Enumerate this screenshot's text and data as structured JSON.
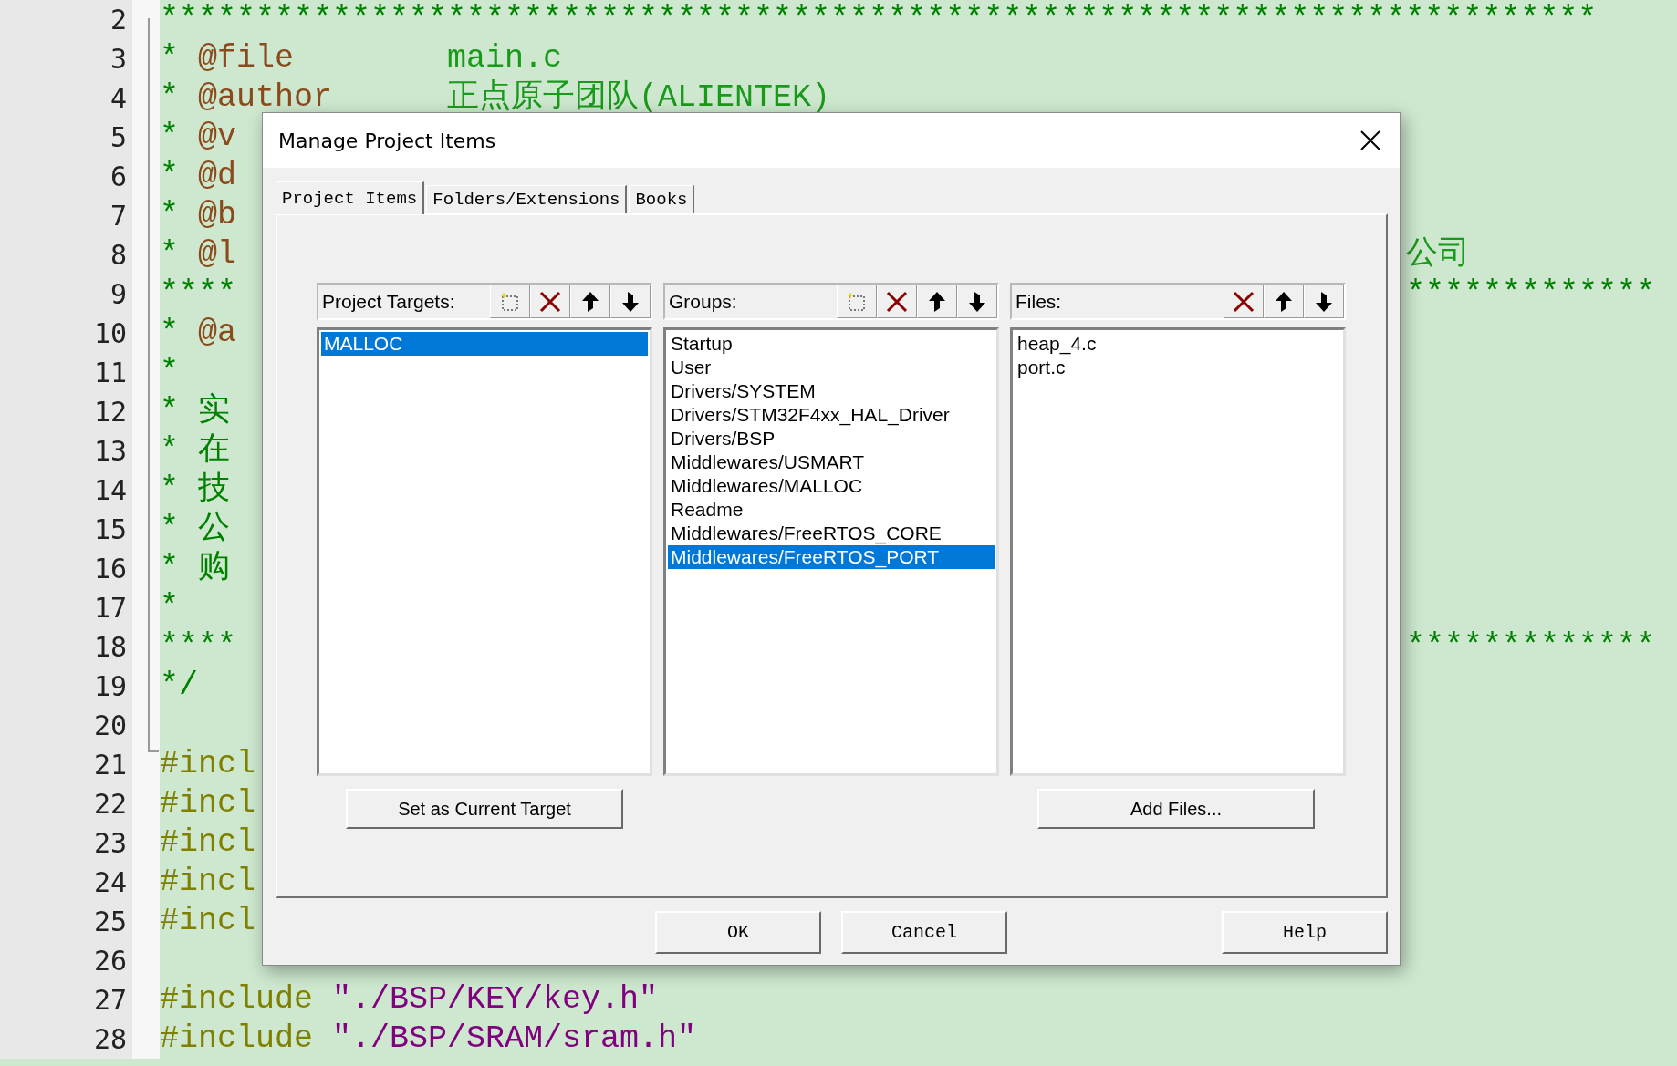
{
  "editor": {
    "lines": [
      {
        "number": "2",
        "parts": [
          {
            "kind": "comment",
            "text": "***************************************************************************"
          }
        ]
      },
      {
        "number": "3",
        "parts": [
          {
            "kind": "comment",
            "text": "* "
          },
          {
            "kind": "tag",
            "text": "@file"
          },
          {
            "kind": "value",
            "text": "        main.c"
          }
        ]
      },
      {
        "number": "4",
        "parts": [
          {
            "kind": "comment",
            "text": "* "
          },
          {
            "kind": "tag",
            "text": "@author"
          },
          {
            "kind": "value",
            "text": "      正点原子团队(ALIENTEK)"
          }
        ]
      },
      {
        "number": "5",
        "parts": [
          {
            "kind": "comment",
            "text": "* "
          },
          {
            "kind": "tag",
            "text": "@v"
          }
        ]
      },
      {
        "number": "6",
        "parts": [
          {
            "kind": "comment",
            "text": "* "
          },
          {
            "kind": "tag",
            "text": "@d"
          }
        ]
      },
      {
        "number": "7",
        "parts": [
          {
            "kind": "comment",
            "text": "* "
          },
          {
            "kind": "tag",
            "text": "@b"
          }
        ]
      },
      {
        "number": "8",
        "parts": [
          {
            "kind": "comment",
            "text": "* "
          },
          {
            "kind": "tag",
            "text": "@l"
          }
        ],
        "right": {
          "kind": "value",
          "text": "公司"
        }
      },
      {
        "number": "9",
        "parts": [
          {
            "kind": "comment",
            "text": "****"
          }
        ],
        "right": {
          "kind": "comment",
          "text": "*************"
        }
      },
      {
        "number": "10",
        "parts": [
          {
            "kind": "comment",
            "text": "* "
          },
          {
            "kind": "tag",
            "text": "@a"
          }
        ]
      },
      {
        "number": "11",
        "parts": [
          {
            "kind": "comment",
            "text": "*"
          }
        ]
      },
      {
        "number": "12",
        "parts": [
          {
            "kind": "comment",
            "text": "* 实"
          }
        ]
      },
      {
        "number": "13",
        "parts": [
          {
            "kind": "comment",
            "text": "* 在"
          }
        ]
      },
      {
        "number": "14",
        "parts": [
          {
            "kind": "comment",
            "text": "* 技"
          }
        ]
      },
      {
        "number": "15",
        "parts": [
          {
            "kind": "comment",
            "text": "* 公"
          }
        ]
      },
      {
        "number": "16",
        "parts": [
          {
            "kind": "comment",
            "text": "* 购"
          }
        ]
      },
      {
        "number": "17",
        "parts": [
          {
            "kind": "comment",
            "text": "*"
          }
        ]
      },
      {
        "number": "18",
        "parts": [
          {
            "kind": "comment",
            "text": "****"
          }
        ],
        "right": {
          "kind": "comment",
          "text": "*************"
        }
      },
      {
        "number": "19",
        "parts": [
          {
            "kind": "comment",
            "text": "*/"
          }
        ]
      },
      {
        "number": "20"
      },
      {
        "number": "21",
        "parts": [
          {
            "kind": "preproc",
            "text": "#incl"
          }
        ]
      },
      {
        "number": "22",
        "parts": [
          {
            "kind": "preproc",
            "text": "#incl"
          }
        ]
      },
      {
        "number": "23",
        "parts": [
          {
            "kind": "preproc",
            "text": "#incl"
          }
        ]
      },
      {
        "number": "24",
        "parts": [
          {
            "kind": "preproc",
            "text": "#incl"
          }
        ]
      },
      {
        "number": "25",
        "parts": [
          {
            "kind": "preproc",
            "text": "#incl"
          }
        ]
      },
      {
        "number": "26"
      },
      {
        "number": "27",
        "parts": [
          {
            "kind": "preproc",
            "text": "#include "
          },
          {
            "kind": "string",
            "text": "\"./BSP/KEY/key.h\""
          }
        ]
      },
      {
        "number": "28",
        "parts": [
          {
            "kind": "preproc",
            "text": "#include "
          },
          {
            "kind": "string",
            "text": "\"./BSP/SRAM/sram.h\""
          }
        ]
      }
    ]
  },
  "dialog": {
    "title": "Manage Project Items",
    "tabs": [
      {
        "label": "Project Items",
        "selected": true
      },
      {
        "label": "Folders/Extensions",
        "selected": false
      },
      {
        "label": "Books",
        "selected": false
      }
    ],
    "columns": [
      {
        "label": "Project Targets:",
        "tools": [
          {
            "kind": "new"
          },
          {
            "kind": "delete"
          },
          {
            "kind": "up"
          },
          {
            "kind": "down"
          }
        ],
        "items": [
          {
            "label": "MALLOC",
            "selected": true
          }
        ],
        "button": "Set as Current Target"
      },
      {
        "label": "Groups:",
        "tools": [
          {
            "kind": "new"
          },
          {
            "kind": "delete"
          },
          {
            "kind": "up"
          },
          {
            "kind": "down"
          }
        ],
        "items": [
          {
            "label": "Startup",
            "selected": false
          },
          {
            "label": "User",
            "selected": false
          },
          {
            "label": "Drivers/SYSTEM",
            "selected": false
          },
          {
            "label": "Drivers/STM32F4xx_HAL_Driver",
            "selected": false
          },
          {
            "label": "Drivers/BSP",
            "selected": false
          },
          {
            "label": "Middlewares/USMART",
            "selected": false
          },
          {
            "label": "Middlewares/MALLOC",
            "selected": false
          },
          {
            "label": "Readme",
            "selected": false
          },
          {
            "label": "Middlewares/FreeRTOS_CORE",
            "selected": false
          },
          {
            "label": "Middlewares/FreeRTOS_PORT",
            "selected": true
          }
        ]
      },
      {
        "label": "Files:",
        "tools": [
          {
            "kind": "delete"
          },
          {
            "kind": "up"
          },
          {
            "kind": "down"
          }
        ],
        "items": [
          {
            "label": "heap_4.c",
            "selected": false
          },
          {
            "label": "port.c",
            "selected": false
          }
        ],
        "button": "Add Files..."
      }
    ],
    "buttons": [
      {
        "label": "OK",
        "kind": "ok"
      },
      {
        "label": "Cancel",
        "kind": "cancel"
      },
      {
        "label": "Help",
        "kind": "help"
      }
    ]
  }
}
